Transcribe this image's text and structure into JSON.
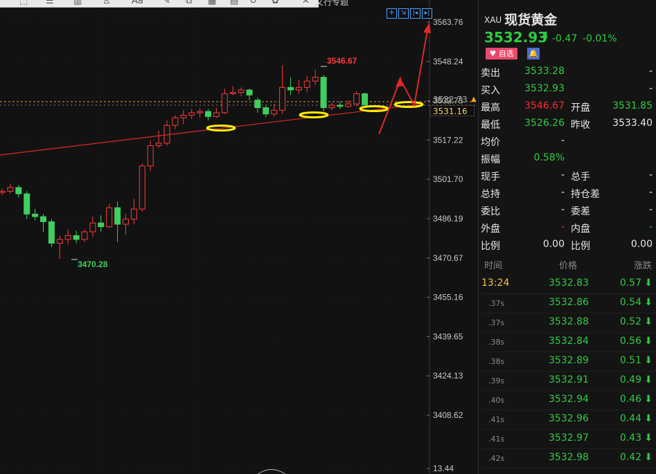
{
  "chart": {
    "y_axis_labels": [
      "3563.76",
      "3548.24",
      "3532.73",
      "3517.22",
      "3501.70",
      "3486.19",
      "3470.67",
      "3455.16",
      "3439.65",
      "3424.13",
      "3408.62",
      "13.44"
    ],
    "current_price_tag": "3531.16",
    "high_label": "3546.67",
    "low_label": "3470.28",
    "tab_fragment": "文行专题",
    "toolbar_icons": [
      "select-icon",
      "menu-icon",
      "bars-icon",
      "person-icon",
      "text-icon",
      "pen-icon",
      "copy-icon",
      "layers-icon",
      "trash-icon",
      "refresh-icon",
      "settings-icon",
      "close-icon"
    ]
  },
  "chart_data": {
    "type": "candlestick",
    "y_range": [
      3400,
      3570
    ],
    "candles": [
      {
        "o": 3496.5,
        "c": 3497.0,
        "h": 3498.0,
        "l": 3495.5
      },
      {
        "o": 3497.0,
        "c": 3498.5,
        "h": 3500.0,
        "l": 3496.0
      },
      {
        "o": 3498.5,
        "c": 3496.0,
        "h": 3499.5,
        "l": 3494.5
      },
      {
        "o": 3496.0,
        "c": 3488.0,
        "h": 3497.0,
        "l": 3486.0
      },
      {
        "o": 3488.0,
        "c": 3487.0,
        "h": 3490.0,
        "l": 3485.5
      },
      {
        "o": 3487.0,
        "c": 3485.0,
        "h": 3488.0,
        "l": 3481.0
      },
      {
        "o": 3485.0,
        "c": 3476.5,
        "h": 3486.0,
        "l": 3475.0
      },
      {
        "o": 3476.5,
        "c": 3478.0,
        "h": 3479.5,
        "l": 3470.28
      },
      {
        "o": 3478.0,
        "c": 3479.5,
        "h": 3482.0,
        "l": 3476.0
      },
      {
        "o": 3479.5,
        "c": 3478.0,
        "h": 3481.5,
        "l": 3476.5
      },
      {
        "o": 3478.0,
        "c": 3481.0,
        "h": 3482.0,
        "l": 3477.0
      },
      {
        "o": 3481.0,
        "c": 3484.5,
        "h": 3487.0,
        "l": 3479.0
      },
      {
        "o": 3484.5,
        "c": 3483.0,
        "h": 3487.5,
        "l": 3481.0
      },
      {
        "o": 3483.0,
        "c": 3490.5,
        "h": 3492.0,
        "l": 3482.5
      },
      {
        "o": 3490.5,
        "c": 3484.0,
        "h": 3493.0,
        "l": 3477.0
      },
      {
        "o": 3484.0,
        "c": 3486.0,
        "h": 3488.0,
        "l": 3480.0
      },
      {
        "o": 3486.0,
        "c": 3490.0,
        "h": 3494.0,
        "l": 3484.0
      },
      {
        "o": 3490.0,
        "c": 3507.0,
        "h": 3508.0,
        "l": 3489.0
      },
      {
        "o": 3507.0,
        "c": 3515.0,
        "h": 3517.0,
        "l": 3505.0
      },
      {
        "o": 3515.0,
        "c": 3516.0,
        "h": 3521.0,
        "l": 3514.0
      },
      {
        "o": 3516.0,
        "c": 3523.0,
        "h": 3525.0,
        "l": 3515.0
      },
      {
        "o": 3523.0,
        "c": 3526.0,
        "h": 3527.0,
        "l": 3521.5
      },
      {
        "o": 3526.0,
        "c": 3527.0,
        "h": 3529.0,
        "l": 3523.5
      },
      {
        "o": 3527.0,
        "c": 3528.0,
        "h": 3529.5,
        "l": 3525.5
      },
      {
        "o": 3528.0,
        "c": 3528.5,
        "h": 3530.0,
        "l": 3526.0
      },
      {
        "o": 3528.5,
        "c": 3526.5,
        "h": 3529.5,
        "l": 3525.0
      },
      {
        "o": 3526.5,
        "c": 3528.0,
        "h": 3530.0,
        "l": 3526.0
      },
      {
        "o": 3528.0,
        "c": 3535.5,
        "h": 3537.5,
        "l": 3527.5
      },
      {
        "o": 3535.5,
        "c": 3536.0,
        "h": 3538.5,
        "l": 3535.0
      },
      {
        "o": 3536.0,
        "c": 3537.0,
        "h": 3538.0,
        "l": 3534.5
      },
      {
        "o": 3537.0,
        "c": 3535.0,
        "h": 3537.5,
        "l": 3533.0
      },
      {
        "o": 3533.0,
        "c": 3530.0,
        "h": 3534.0,
        "l": 3528.0
      },
      {
        "o": 3530.0,
        "c": 3527.5,
        "h": 3531.0,
        "l": 3526.26
      },
      {
        "o": 3527.5,
        "c": 3529.0,
        "h": 3531.5,
        "l": 3526.5
      },
      {
        "o": 3529.0,
        "c": 3538.0,
        "h": 3546.67,
        "l": 3527.5
      },
      {
        "o": 3538.0,
        "c": 3537.0,
        "h": 3542.0,
        "l": 3535.0
      },
      {
        "o": 3537.0,
        "c": 3538.0,
        "h": 3541.0,
        "l": 3535.5
      },
      {
        "o": 3538.0,
        "c": 3540.5,
        "h": 3542.5,
        "l": 3536.0
      },
      {
        "o": 3540.5,
        "c": 3542.0,
        "h": 3545.0,
        "l": 3539.0
      },
      {
        "o": 3542.0,
        "c": 3530.0,
        "h": 3543.0,
        "l": 3528.5
      },
      {
        "o": 3530.0,
        "c": 3531.0,
        "h": 3532.0,
        "l": 3529.0
      },
      {
        "o": 3531.0,
        "c": 3530.5,
        "h": 3532.5,
        "l": 3529.5
      },
      {
        "o": 3530.5,
        "c": 3531.5,
        "h": 3533.0,
        "l": 3530.0
      },
      {
        "o": 3531.5,
        "c": 3535.5,
        "h": 3536.5,
        "l": 3530.5
      },
      {
        "o": 3535.5,
        "c": 3531.16,
        "h": 3536.0,
        "l": 3530.5
      }
    ]
  },
  "panel": {
    "symbol": "XAU",
    "name": "现货黄金",
    "last": "3532.93",
    "change": "-0.47",
    "change_pct": "-0.01%",
    "fav_label": "自选",
    "bell_label": "🔔",
    "quote_rows": [
      {
        "l1": "卖出",
        "v1": "3533.28",
        "c1": "green",
        "l2": "",
        "v2": "-",
        "c2": "white"
      },
      {
        "l1": "买入",
        "v1": "3532.93",
        "c1": "green",
        "l2": "",
        "v2": "-",
        "c2": "white"
      },
      {
        "l1": "最高",
        "v1": "3546.67",
        "c1": "red",
        "l2": "开盘",
        "v2": "3531.85",
        "c2": "green"
      },
      {
        "l1": "最低",
        "v1": "3526.26",
        "c1": "green",
        "l2": "昨收",
        "v2": "3533.40",
        "c2": "white"
      },
      {
        "l1": "均价",
        "v1": "-",
        "c1": "white",
        "l2": "",
        "v2": "",
        "c2": "white"
      },
      {
        "l1": "振幅",
        "v1": "0.58%",
        "c1": "green",
        "l2": "",
        "v2": "",
        "c2": "white"
      },
      {
        "l1": "现手",
        "v1": "-",
        "c1": "white",
        "l2": "总手",
        "v2": "-",
        "c2": "white"
      },
      {
        "l1": "总持",
        "v1": "-",
        "c1": "white",
        "l2": "持仓差",
        "v2": "-",
        "c2": "white"
      },
      {
        "l1": "委比",
        "v1": "-",
        "c1": "white",
        "l2": "委差",
        "v2": "-",
        "c2": "white"
      },
      {
        "l1": "外盘",
        "v1": "-",
        "c1": "red",
        "l2": "内盘",
        "v2": "-",
        "c2": "green"
      },
      {
        "l1": "比例",
        "v1": "0.00",
        "c1": "white",
        "l2": "比例",
        "v2": "0.00",
        "c2": "white"
      }
    ],
    "ticks_header": {
      "time": "时间",
      "price": "价格",
      "change": "涨跌"
    },
    "ticks": [
      {
        "time": "13:24",
        "price": "3532.83",
        "chg": "0.57"
      },
      {
        "time": ".37s",
        "price": "3532.86",
        "chg": "0.54"
      },
      {
        "time": ".37s",
        "price": "3532.88",
        "chg": "0.52"
      },
      {
        "time": ".38s",
        "price": "3532.84",
        "chg": "0.56"
      },
      {
        "time": ".38s",
        "price": "3532.89",
        "chg": "0.51"
      },
      {
        "time": ".39s",
        "price": "3532.91",
        "chg": "0.49"
      },
      {
        "time": ".40s",
        "price": "3532.94",
        "chg": "0.46"
      },
      {
        "time": ".41s",
        "price": "3532.96",
        "chg": "0.44"
      },
      {
        "time": ".41s",
        "price": "3532.97",
        "chg": "0.43"
      },
      {
        "time": ".42s",
        "price": "3532.98",
        "chg": "0.42"
      }
    ]
  }
}
